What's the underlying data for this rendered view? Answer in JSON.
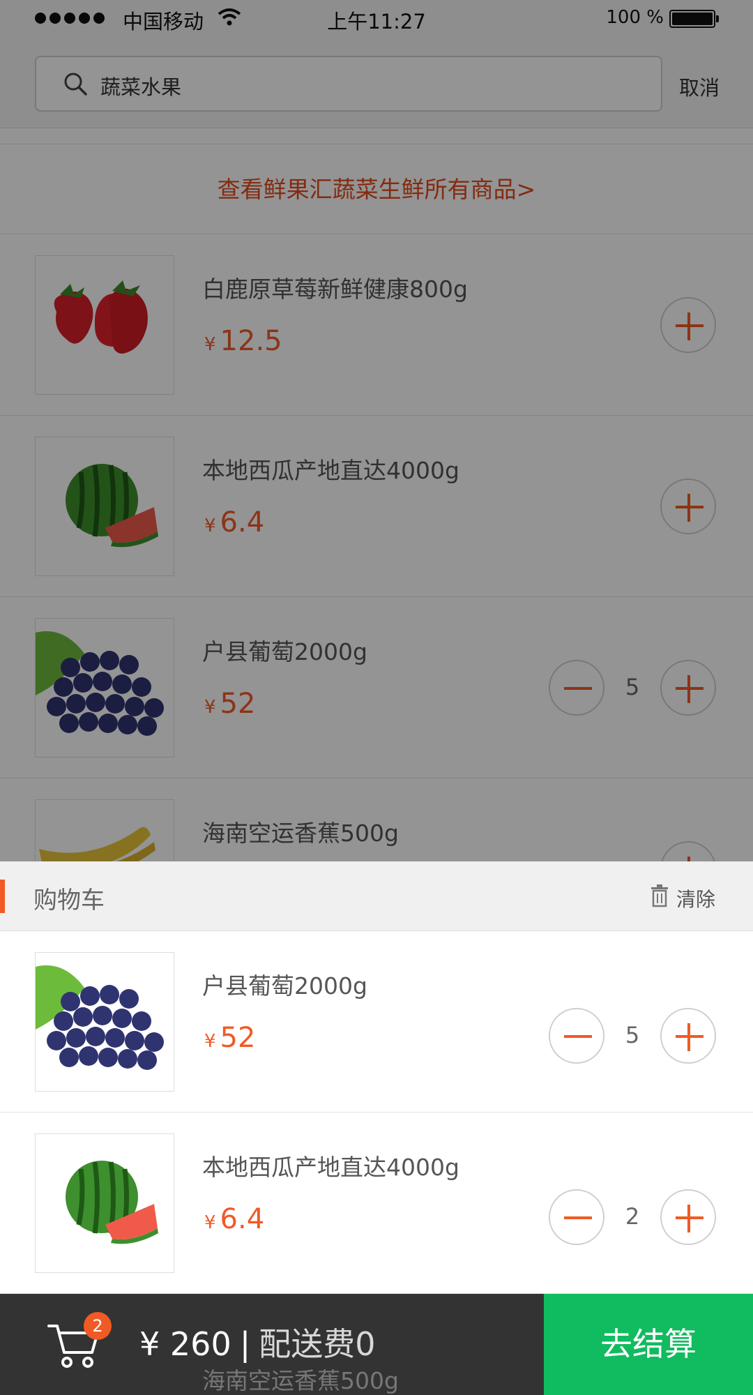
{
  "status": {
    "carrier": "中国移动",
    "time": "上午11:27",
    "battery": "100 %"
  },
  "search": {
    "query": "蔬菜水果",
    "cancel": "取消"
  },
  "view_all": "查看鲜果汇蔬菜生鲜所有商品>",
  "currency": "¥",
  "products": [
    {
      "name": "白鹿原草莓新鲜健康800g",
      "price": "12.5"
    },
    {
      "name": "本地西瓜产地直达4000g",
      "price": "6.4"
    },
    {
      "name": "户县葡萄2000g",
      "price": "52",
      "qty": "5"
    },
    {
      "name": "海南空运香蕉500g"
    }
  ],
  "cart": {
    "title": "购物车",
    "clear": "清除",
    "items": [
      {
        "name": "户县葡萄2000g",
        "price": "52",
        "qty": "5"
      },
      {
        "name": "本地西瓜产地直达4000g",
        "price": "6.4",
        "qty": "2"
      }
    ]
  },
  "bottom_bar": {
    "badge": "2",
    "currency": "¥",
    "total": "260",
    "separator": "|",
    "delivery_fee": "配送费0",
    "checkout": "去结算"
  },
  "colors": {
    "accent": "#f05a28",
    "checkout": "#11bb5f",
    "bar": "#333333"
  }
}
